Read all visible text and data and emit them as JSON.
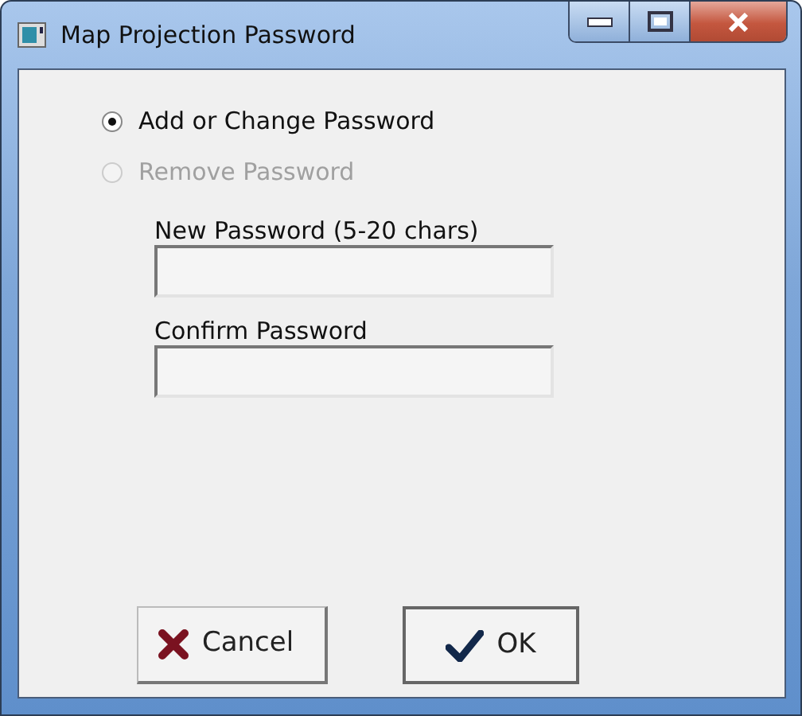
{
  "window": {
    "title": "Map Projection Password"
  },
  "options": [
    {
      "label": "Add or Change Password",
      "selected": true,
      "disabled": false
    },
    {
      "label": "Remove Password",
      "selected": false,
      "disabled": true
    }
  ],
  "fields": [
    {
      "label": "New Password (5-20 chars)"
    },
    {
      "label": "Confirm Password"
    }
  ],
  "buttons": [
    {
      "kind": "cancel",
      "label": "Cancel"
    },
    {
      "kind": "ok",
      "label": "OK"
    }
  ]
}
